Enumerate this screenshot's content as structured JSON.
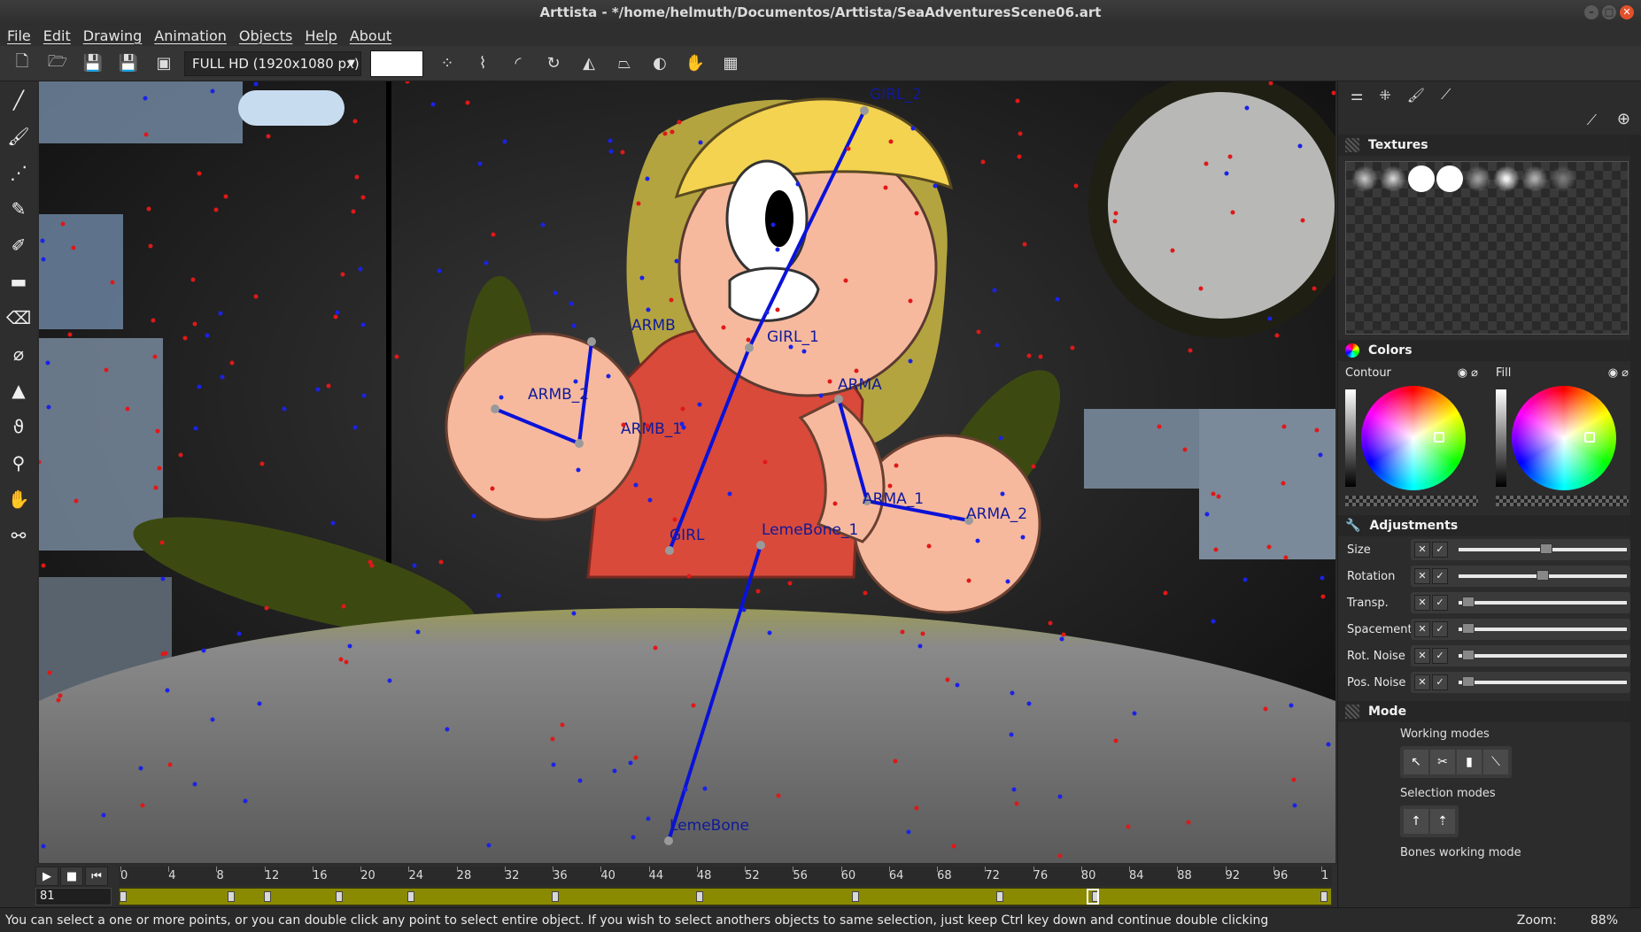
{
  "window": {
    "title": "Arttista - */home/helmuth/Documentos/Arttista/SeaAdventuresScene06.art"
  },
  "menu": [
    "File",
    "Edit",
    "Drawing",
    "Animation",
    "Objects",
    "Help",
    "About"
  ],
  "toolbar": {
    "resolution": "FULL HD (1920x1080 px)",
    "color_swatch": "#ffffff"
  },
  "tools": [
    "pencil-icon",
    "brush-icon",
    "dotted-line-icon",
    "pen-icon",
    "marker-icon",
    "eraser-icon",
    "rubber-icon",
    "eyedropper-icon",
    "shapes-icon",
    "hook-icon",
    "magnifier-icon",
    "hand-icon",
    "bone-icon"
  ],
  "canvas": {
    "bone_labels": [
      "GIRL_2",
      "ARMB",
      "GIRL_1",
      "ARMA",
      "ARMB_2",
      "ARMB_1",
      "ARMA_1",
      "ARMA_2",
      "GIRL",
      "LemeBone_1",
      "LemeBone"
    ]
  },
  "panel": {
    "textures_title": "Textures",
    "colors_title": "Colors",
    "contour_label": "Contour",
    "fill_label": "Fill",
    "adjustments_title": "Adjustments",
    "adjustments": [
      {
        "name": "Size",
        "value": 0.52
      },
      {
        "name": "Rotation",
        "value": 0.5
      },
      {
        "name": "Transp.",
        "value": 0.02
      },
      {
        "name": "Spacement",
        "value": 0.02
      },
      {
        "name": "Rot. Noise",
        "value": 0.02
      },
      {
        "name": "Pos. Noise",
        "value": 0.02
      }
    ],
    "mode_title": "Mode",
    "working_modes_label": "Working modes",
    "selection_modes_label": "Selection modes",
    "bones_working_mode_label": "Bones working mode"
  },
  "timeline": {
    "current_frame": "81",
    "ticks": [
      "0",
      "4",
      "8",
      "12",
      "16",
      "20",
      "24",
      "28",
      "32",
      "36",
      "40",
      "44",
      "48",
      "52",
      "56",
      "60",
      "64",
      "68",
      "72",
      "76",
      "80",
      "84",
      "88",
      "92",
      "96",
      "1"
    ],
    "keyframes": [
      0,
      9,
      12,
      18,
      24,
      36,
      48,
      61,
      73,
      81,
      100
    ]
  },
  "status": {
    "message": "You can select a one or more points, or you can double click any point to select entire object. If you wish to select anothers objects to same selection, just keep Ctrl key down and continue double clicking",
    "zoom_label": "Zoom:",
    "zoom_value": "88%"
  },
  "colors": {
    "bone": "#0a12d8",
    "timeline_track": "#8a8a00",
    "skin": "#f7b99e",
    "shirt": "#d94a3a",
    "hair": "#f3d34f"
  }
}
